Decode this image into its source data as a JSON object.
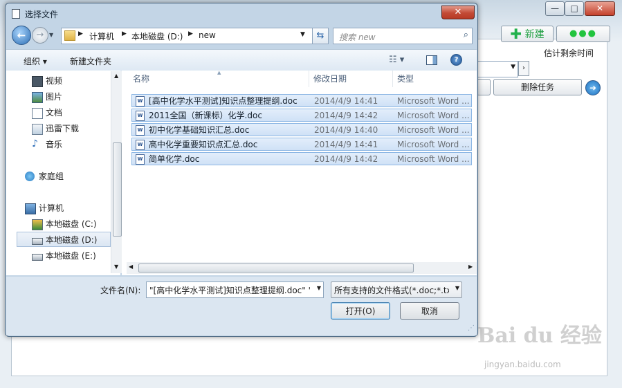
{
  "background_app": {
    "new_button": "新建",
    "more_button": "●●●",
    "column_estimated_time": "估计剩余时间",
    "delete_task_button": "删除任务",
    "window_controls": {
      "minimize": "—",
      "maximize": "□",
      "close": "✕"
    }
  },
  "dialog": {
    "title": "选择文件",
    "close_label": "✕",
    "breadcrumb": [
      "计算机",
      "本地磁盘 (D:)",
      "new"
    ],
    "search_placeholder": "搜索 new",
    "toolbar": {
      "organize": "组织 ▾",
      "new_folder": "新建文件夹"
    },
    "nav": {
      "libraries": [
        {
          "label": "视频",
          "icon": "video-icon"
        },
        {
          "label": "图片",
          "icon": "picture-icon"
        },
        {
          "label": "文档",
          "icon": "document-icon"
        },
        {
          "label": "迅雷下载",
          "icon": "download-icon"
        },
        {
          "label": "音乐",
          "icon": "music-icon"
        }
      ],
      "homegroup": "家庭组",
      "computer": "计算机",
      "drives": [
        "本地磁盘 (C:)",
        "本地磁盘 (D:)",
        "本地磁盘 (E:)"
      ],
      "selected_drive_index": 1
    },
    "columns": {
      "name": "名称",
      "modified": "修改日期",
      "type": "类型"
    },
    "files": [
      {
        "name": "[高中化学水平测试]知识点整理提纲.doc",
        "modified": "2014/4/9 14:41",
        "type": "Microsoft Word ..."
      },
      {
        "name": "2011全国（新课标）化学.doc",
        "modified": "2014/4/9 14:42",
        "type": "Microsoft Word ..."
      },
      {
        "name": "初中化学基础知识汇总.doc",
        "modified": "2014/4/9 14:40",
        "type": "Microsoft Word ..."
      },
      {
        "name": "高中化学重要知识点汇总.doc",
        "modified": "2014/4/9 14:41",
        "type": "Microsoft Word ..."
      },
      {
        "name": "简单化学.doc",
        "modified": "2014/4/9 14:42",
        "type": "Microsoft Word ..."
      }
    ],
    "filename_label": "文件名(N):",
    "filename_value": "\"[高中化学水平测试]知识点整理提纲.doc\" \":",
    "filter_value": "所有支持的文件格式(*.doc;*.tx",
    "open_button": "打开(O)",
    "cancel_button": "取消"
  },
  "watermark": {
    "brand": "Bai du 经验",
    "url": "jingyan.baidu.com"
  },
  "colors": {
    "selection": "#cfe1f6",
    "dialog_chrome": "#c3d5e6",
    "new_icon": "#22b14c"
  }
}
